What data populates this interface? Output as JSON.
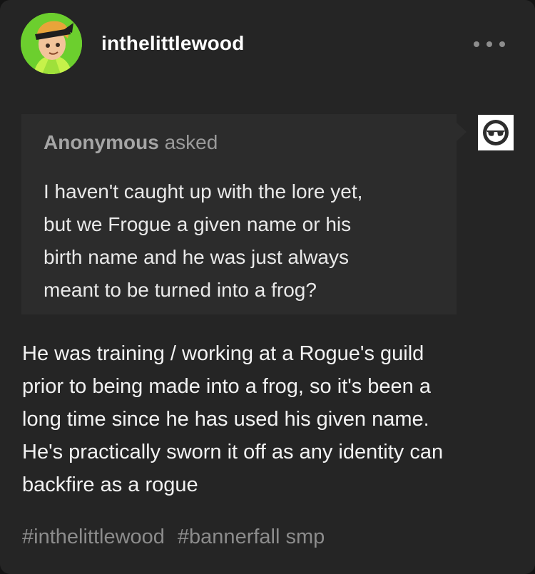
{
  "post": {
    "username": "inthelittlewood",
    "ask": {
      "asker": "Anonymous",
      "asked_word": "asked",
      "question_lines": [
        "I haven't caught up with the lore yet,",
        "but we Frogue a given name or his",
        "birth name and he was just always",
        "meant to be turned into a frog?"
      ]
    },
    "answer_lines": [
      "He was training / working at a Rogue's guild",
      "prior to being made into a frog, so it's been a",
      "long time since he has used his given name.",
      "He's practically sworn it off as any identity can",
      "backfire as a rogue"
    ],
    "tags": [
      "#inthelittlewood",
      "#bannerfall smp"
    ]
  },
  "icons": {
    "avatar": "cartoon-character-avatar",
    "more": "more-options-icon",
    "asker_avatar": "sunglasses-face-icon"
  },
  "colors": {
    "card_background": "#252525",
    "ask_background": "#2c2c2c",
    "avatar_background": "#6ccf2e",
    "tag_color": "#8c8c8c"
  }
}
